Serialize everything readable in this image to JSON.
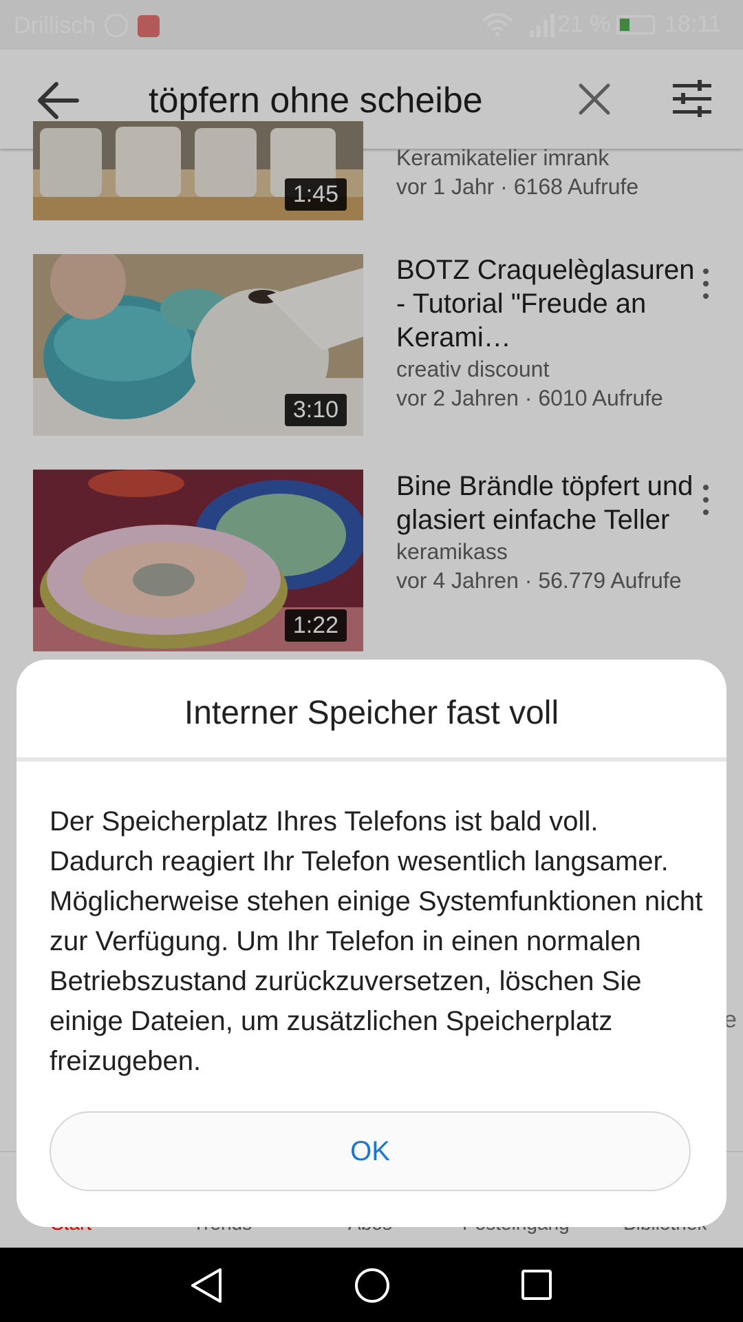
{
  "status_bar": {
    "carrier": "Drillisch",
    "battery": "21 %",
    "time": "18:11",
    "icons": [
      "whatsapp-icon",
      "mail-icon",
      "wifi-icon",
      "signal-icon",
      "battery-icon"
    ]
  },
  "search": {
    "query": "töpfern ohne scheibe"
  },
  "videos": [
    {
      "duration": "1:45",
      "title": "",
      "channel": "Keramikatelier imrank",
      "stats": "vor 1 Jahr · 6168 Aufrufe"
    },
    {
      "duration": "3:10",
      "title": "BOTZ Craquelègla­suren - Tutorial \"Freude an Kerami…",
      "channel": "creativ discount",
      "stats": "vor 2 Jahren · 6010 Aufrufe"
    },
    {
      "duration": "1:22",
      "title": "Bine Brändle töpfert und glasiert einfache Teller",
      "channel": "keramikass",
      "stats": "vor 4 Jahren · 56.779 Aufrufe"
    }
  ],
  "bottom_nav": {
    "items": [
      "Start",
      "Trends",
      "Abos",
      "Posteingang",
      "Bibliothek"
    ],
    "active": "Start"
  },
  "dialog": {
    "title": "Interner Speicher fast voll",
    "body": "Der Speicherplatz Ihres Telefons ist bald voll. Dadurch reagiert Ihr Telefon wesentlich langsamer. Möglicherweise stehen einige Systemfunktionen nicht zur Verfügung. Um Ihr Telefon in einen normalen Betriebszustand zurückzuversetzen, löschen Sie einige Dateien, um zusätzlichen Speicherplatz freizugeben.",
    "ok_label": "OK"
  },
  "peek_char": "e",
  "colors": {
    "accent_red": "#ff0000",
    "ok_blue": "#1976d2"
  }
}
